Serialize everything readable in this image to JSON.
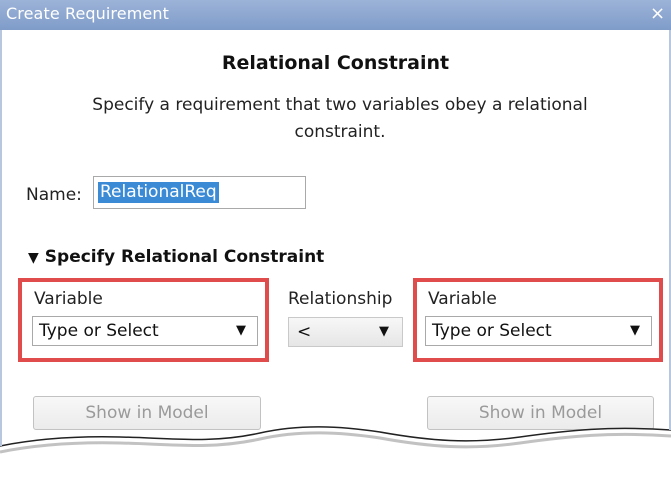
{
  "window": {
    "title": "Create Requirement",
    "close_glyph": "×"
  },
  "heading": "Relational Constraint",
  "description": "Specify a requirement that two variables obey a relational constraint.",
  "name_field": {
    "label": "Name:",
    "value": "RelationalReq"
  },
  "section": {
    "toggle_glyph": "▼",
    "title": "Specify Relational Constraint"
  },
  "left_variable": {
    "label": "Variable",
    "value": "Type or Select",
    "arrow": "▼"
  },
  "relationship": {
    "label": "Relationship",
    "value": "<",
    "arrow": "▼"
  },
  "right_variable": {
    "label": "Variable",
    "value": "Type or Select",
    "arrow": "▼"
  },
  "buttons": {
    "show_left": "Show in Model",
    "show_right": "Show in Model"
  },
  "colors": {
    "titlebar": "#8ea8d2",
    "highlight": "#e04b4b",
    "selection": "#3a8ad6"
  }
}
